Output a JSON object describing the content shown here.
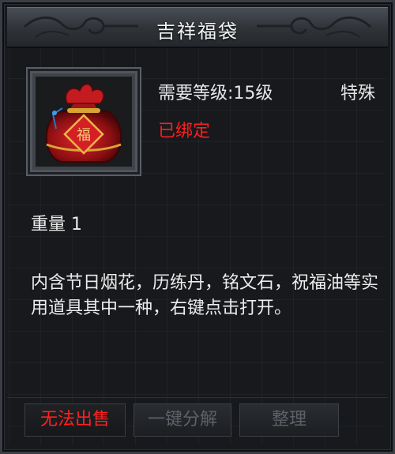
{
  "window": {
    "title": "吉祥福袋"
  },
  "item": {
    "icon": "lucky-bag-icon",
    "bag_label": "福",
    "level_requirement": "需要等级:15级",
    "type": "特殊",
    "bind_status": "已绑定",
    "weight": "重量 1",
    "description": "内含节日烟花，历练丹，铭文石，祝福油等实用道具其中一种，右键点击打开。"
  },
  "actions": {
    "cannot_sell": "无法出售",
    "one_click_decompose": "一键分解",
    "sort": "整理"
  },
  "colors": {
    "bound_red": "#ff1e1e",
    "text": "#ececec",
    "disabled": "#5e6268"
  }
}
